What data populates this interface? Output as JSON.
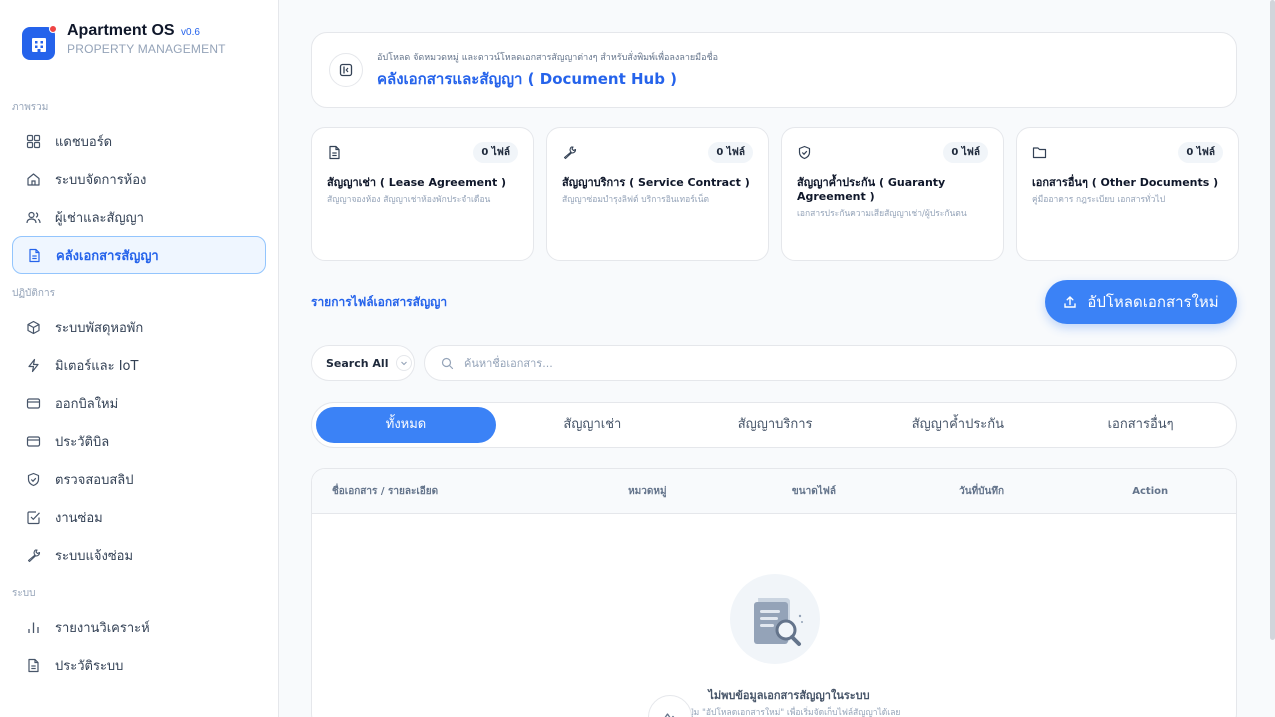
{
  "brand": {
    "title": "Apartment OS",
    "version": "v0.6",
    "subtitle": "PROPERTY MANAGEMENT"
  },
  "sidebar": {
    "sections": [
      {
        "label": "ภาพรวม",
        "items": [
          {
            "label": "แดชบอร์ด",
            "icon": "dashboard-grid-icon"
          },
          {
            "label": "ระบบจัดการห้อง",
            "icon": "home-icon"
          },
          {
            "label": "ผู้เช่าและสัญญา",
            "icon": "users-icon"
          },
          {
            "label": "คลังเอกสารสัญญา",
            "icon": "document-icon",
            "active": true
          }
        ]
      },
      {
        "label": "ปฏิบัติการ",
        "items": [
          {
            "label": "ระบบพัสดุหอพัก",
            "icon": "package-icon"
          },
          {
            "label": "มิเตอร์และ IoT",
            "icon": "lightning-icon"
          },
          {
            "label": "ออกบิลใหม่",
            "icon": "card-icon"
          },
          {
            "label": "ประวัติบิล",
            "icon": "card-icon"
          },
          {
            "label": "ตรวจสอบสลิป",
            "icon": "shield-check-icon"
          },
          {
            "label": "งานซ่อม",
            "icon": "checkbox-icon"
          },
          {
            "label": "ระบบแจ้งซ่อม",
            "icon": "wrench-icon"
          }
        ]
      },
      {
        "label": "ระบบ",
        "items": [
          {
            "label": "รายงานวิเคราะห์",
            "icon": "bar-chart-icon"
          },
          {
            "label": "ประวัติระบบ",
            "icon": "document-icon"
          }
        ]
      }
    ]
  },
  "header": {
    "subtitle": "อัปโหลด จัดหมวดหมู่ และดาวน์โหลดเอกสารสัญญาต่างๆ สำหรับสั่งพิมพ์เพื่อลงลายมือชื่อ",
    "title": "คลังเอกสารและสัญญา ( Document Hub )"
  },
  "cards": [
    {
      "icon": "document-icon",
      "count": "0 ไฟล์",
      "title": "สัญญาเช่า ( Lease Agreement )",
      "desc": "สัญญาจองห้อง สัญญาเช่าห้องพักประจำเดือน"
    },
    {
      "icon": "wrench-icon",
      "count": "0 ไฟล์",
      "title": "สัญญาบริการ ( Service Contract )",
      "desc": "สัญญาซ่อมบำรุงลิฟต์ บริการอินเทอร์เน็ต"
    },
    {
      "icon": "shield-check-icon",
      "count": "0 ไฟล์",
      "title": "สัญญาค้ำประกัน ( Guaranty Agreement )",
      "desc": "เอกสารประกันความเสียสัญญาเช่า/ผู้ประกันตน"
    },
    {
      "icon": "folder-icon",
      "count": "0 ไฟล์",
      "title": "เอกสารอื่นๆ ( Other Documents )",
      "desc": "คู่มืออาคาร กฎระเบียบ เอกสารทั่วไป"
    }
  ],
  "list": {
    "title": "รายการไฟล์เอกสารสัญญา",
    "upload_label": "อัปโหลดเอกสารใหม่"
  },
  "search": {
    "scope_label": "Search All",
    "placeholder": "ค้นหาชื่อเอกสาร..."
  },
  "tabs": [
    {
      "label": "ทั้งหมด",
      "active": true
    },
    {
      "label": "สัญญาเช่า"
    },
    {
      "label": "สัญญาบริการ"
    },
    {
      "label": "สัญญาค้ำประกัน"
    },
    {
      "label": "เอกสารอื่นๆ"
    }
  ],
  "table": {
    "columns": [
      "ชื่อเอกสาร / รายละเอียด",
      "หมวดหมู่",
      "ขนาดไฟล์",
      "วันที่บันทึก",
      "Action"
    ],
    "empty_title": "ไม่พบข้อมูลเอกสารสัญญาในระบบ",
    "empty_sub": "กดปุ่ม \"อัปโหลดเอกสารใหม่\" เพื่อเริ่มจัดเก็บไฟล์สัญญาได้เลย"
  },
  "colors": {
    "accent": "#2563eb",
    "button": "#3b82f6"
  }
}
